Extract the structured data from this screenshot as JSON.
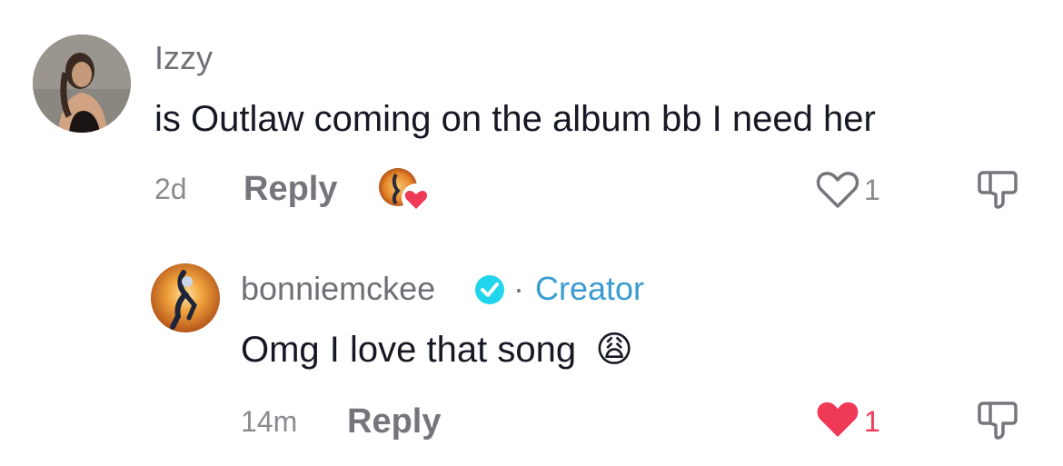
{
  "comments": [
    {
      "username": "Izzy",
      "text": "is Outlaw coming on the album bb I need her",
      "time": "2d",
      "reply_label": "Reply",
      "like_count": "1",
      "liked": false,
      "creator_liked": true
    }
  ],
  "reply": {
    "username": "bonniemckee",
    "verified": true,
    "separator": "·",
    "badge": "Creator",
    "text": "Omg I love that song",
    "emoji": "😩",
    "time": "14m",
    "reply_label": "Reply",
    "like_count": "1",
    "liked": true
  },
  "colors": {
    "like_red": "#ef3a57",
    "creator_blue": "#3a9bd0",
    "verified_blue": "#20d5ec"
  },
  "icons": {
    "like": "heart-outline-icon",
    "liked": "heart-filled-icon",
    "dislike": "thumbs-down-icon",
    "verified": "verified-badge-icon"
  }
}
